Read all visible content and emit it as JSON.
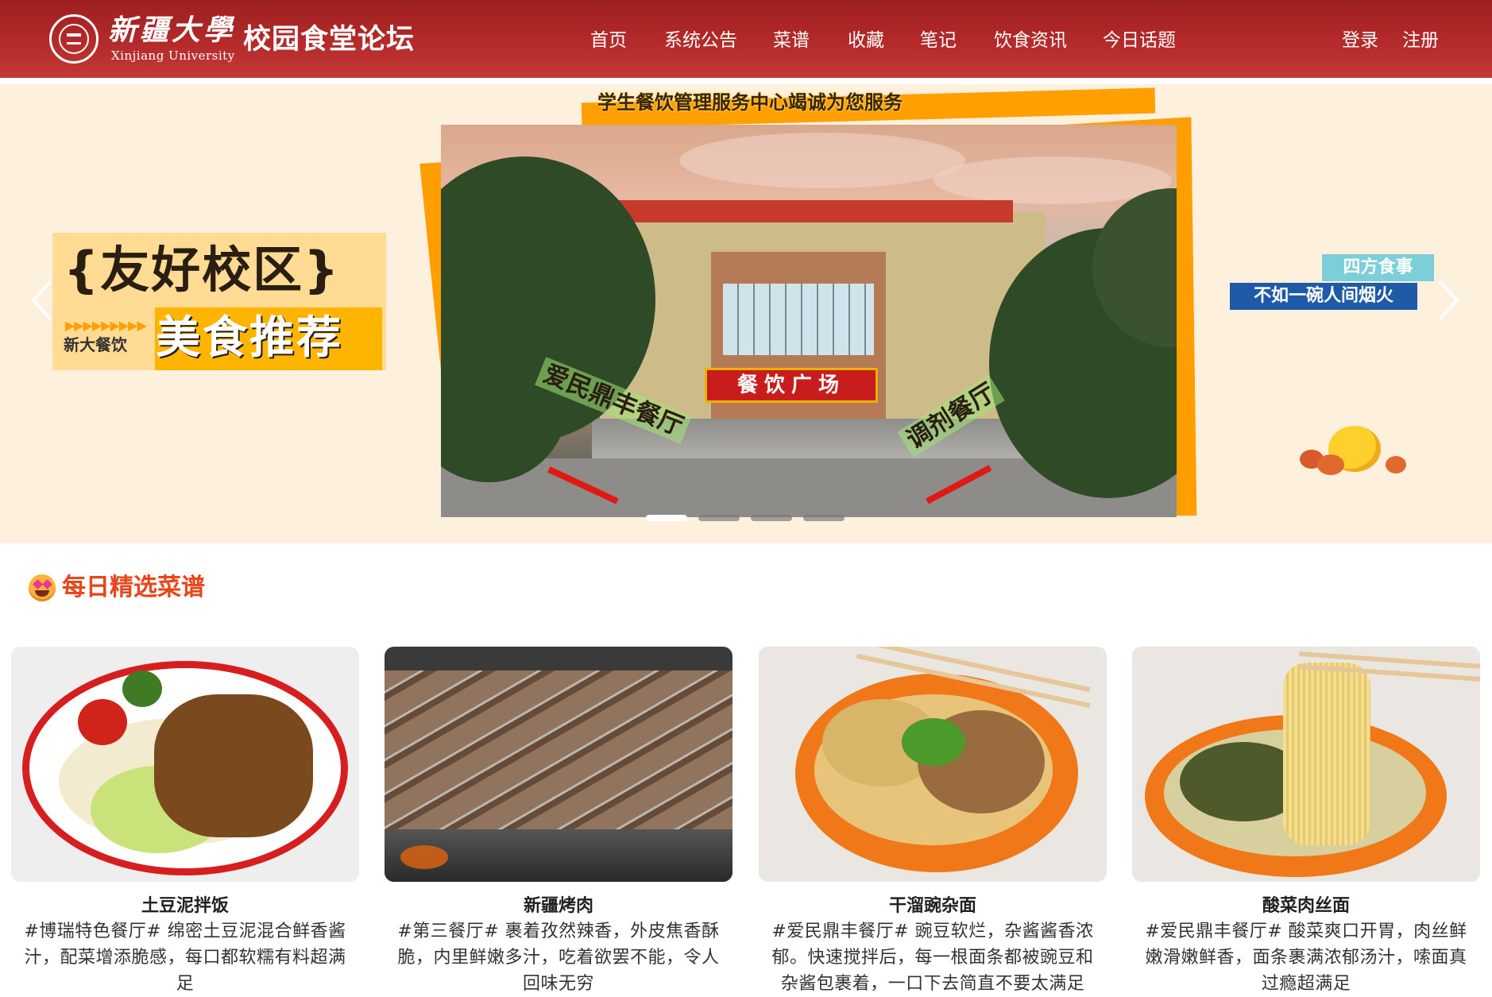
{
  "header": {
    "logo_cn": "新疆大學",
    "logo_en": "Xinjiang University",
    "site_title": "校园食堂论坛",
    "nav": [
      {
        "label": "首页"
      },
      {
        "label": "系统公告"
      },
      {
        "label": "菜谱"
      },
      {
        "label": "收藏"
      },
      {
        "label": "笔记"
      },
      {
        "label": "饮食资讯"
      },
      {
        "label": "今日话题"
      }
    ],
    "login_label": "登录",
    "register_label": "注册"
  },
  "banner": {
    "top_slogan": "学生餐饮管理服务中心竭诚为您服务",
    "left_title": "{友好校区}",
    "left_subtitle": "美食推荐",
    "left_brand": "新大餐饮",
    "right_line1": "四方食事",
    "right_line2": "不如一碗人间烟火",
    "photo_sign": "餐饮广场",
    "photo_label_left": "爱民鼎丰餐厅",
    "photo_label_right": "调剂餐厅",
    "slide_count": 4,
    "active_slide": 1
  },
  "section": {
    "title": "每日精选菜谱",
    "title_emoji": "star-struck-emoji"
  },
  "recipes": [
    {
      "name": "土豆泥拌饭",
      "desc": "#博瑞特色餐厅# 绵密土豆泥混合鲜香酱汁，配菜增添脆感，每口都软糯有料超满足"
    },
    {
      "name": "新疆烤肉",
      "desc": "#第三餐厅# 裹着孜然辣香，外皮焦香酥脆，内里鲜嫩多汁，吃着欲罢不能，令人回味无穷"
    },
    {
      "name": "干溜豌杂面",
      "desc": "#爱民鼎丰餐厅# 豌豆软烂，杂酱酱香浓郁。快速搅拌后，每一根面条都被豌豆和杂酱包裹着，一口下去简直不要太满足"
    },
    {
      "name": "酸菜肉丝面",
      "desc": "#爱民鼎丰餐厅# 酸菜爽口开胃，肉丝鲜嫩滑嫩鲜香，面条裹满浓郁汤汁，嗦面真过瘾超满足"
    }
  ],
  "colors": {
    "header_red": "#b42a2a",
    "banner_bg": "#fdf0dd",
    "accent_orange": "#ff9e00",
    "section_title": "#e9441a"
  }
}
